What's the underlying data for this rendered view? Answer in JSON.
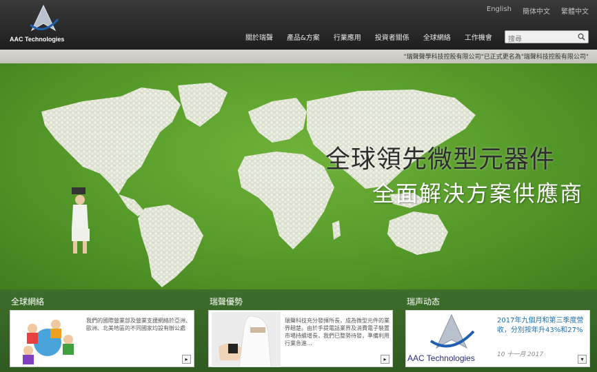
{
  "brand": {
    "name": "AAC Technologies"
  },
  "languages": [
    "English",
    "簡体中文",
    "繁體中文"
  ],
  "nav": [
    "關於瑞聲",
    "產品&方案",
    "行業應用",
    "投資者關係",
    "全球網絡",
    "工作機會"
  ],
  "search": {
    "placeholder": "搜尋"
  },
  "notice": "\"瑞聲聲學科技控股有限公司\"已正式更名為\"瑞聲科技控股有限公司\"",
  "hero": {
    "headline1": "全球領先微型元器件",
    "headline2": "全面解決方案供應商"
  },
  "panels": [
    {
      "title": "全球網絡",
      "text": "我們的國際營業部及營業支援網絡於亞洲、歐洲、北美地區的不同國家均設有辦公處"
    },
    {
      "title": "瑞聲優勢",
      "text": "瑞聲科技充分發揮所長，成為微型元件的業界翹楚。由於手提電話業界及消費電子裝置市場持續增長，我們已整勢待發，準備利用行業急進..."
    },
    {
      "title": "瑞声动态",
      "news_title": "2017年九個月和第三季度營收，分別按年升43%和27%",
      "news_date": "10 十一月 2017",
      "logo_text": "AAC Technologies"
    }
  ],
  "colors": {
    "header": "#2a2a2a",
    "grass": "#5a9f2c",
    "panel_bg": "#3d6e2a",
    "news_blue": "#1a6fb0"
  }
}
